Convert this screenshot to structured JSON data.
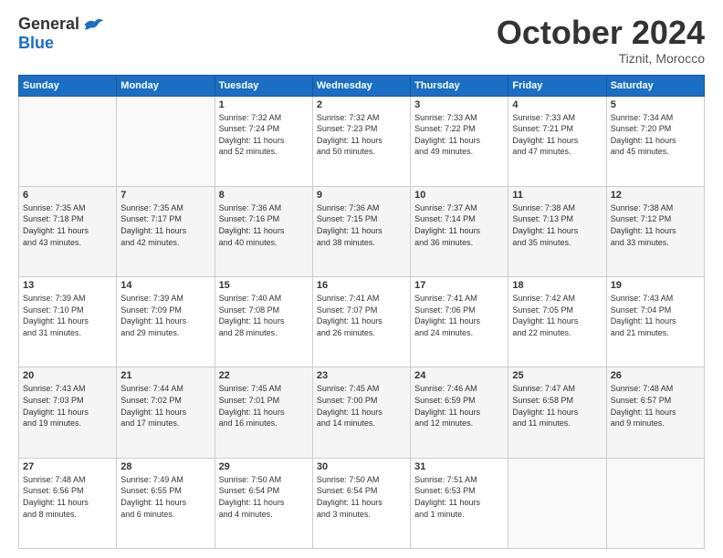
{
  "logo": {
    "general": "General",
    "blue": "Blue"
  },
  "title": "October 2024",
  "location": "Tiznit, Morocco",
  "days_of_week": [
    "Sunday",
    "Monday",
    "Tuesday",
    "Wednesday",
    "Thursday",
    "Friday",
    "Saturday"
  ],
  "weeks": [
    {
      "shaded": false,
      "days": [
        {
          "day": "",
          "info": ""
        },
        {
          "day": "",
          "info": ""
        },
        {
          "day": "1",
          "info": "Sunrise: 7:32 AM\nSunset: 7:24 PM\nDaylight: 11 hours\nand 52 minutes."
        },
        {
          "day": "2",
          "info": "Sunrise: 7:32 AM\nSunset: 7:23 PM\nDaylight: 11 hours\nand 50 minutes."
        },
        {
          "day": "3",
          "info": "Sunrise: 7:33 AM\nSunset: 7:22 PM\nDaylight: 11 hours\nand 49 minutes."
        },
        {
          "day": "4",
          "info": "Sunrise: 7:33 AM\nSunset: 7:21 PM\nDaylight: 11 hours\nand 47 minutes."
        },
        {
          "day": "5",
          "info": "Sunrise: 7:34 AM\nSunset: 7:20 PM\nDaylight: 11 hours\nand 45 minutes."
        }
      ]
    },
    {
      "shaded": true,
      "days": [
        {
          "day": "6",
          "info": "Sunrise: 7:35 AM\nSunset: 7:18 PM\nDaylight: 11 hours\nand 43 minutes."
        },
        {
          "day": "7",
          "info": "Sunrise: 7:35 AM\nSunset: 7:17 PM\nDaylight: 11 hours\nand 42 minutes."
        },
        {
          "day": "8",
          "info": "Sunrise: 7:36 AM\nSunset: 7:16 PM\nDaylight: 11 hours\nand 40 minutes."
        },
        {
          "day": "9",
          "info": "Sunrise: 7:36 AM\nSunset: 7:15 PM\nDaylight: 11 hours\nand 38 minutes."
        },
        {
          "day": "10",
          "info": "Sunrise: 7:37 AM\nSunset: 7:14 PM\nDaylight: 11 hours\nand 36 minutes."
        },
        {
          "day": "11",
          "info": "Sunrise: 7:38 AM\nSunset: 7:13 PM\nDaylight: 11 hours\nand 35 minutes."
        },
        {
          "day": "12",
          "info": "Sunrise: 7:38 AM\nSunset: 7:12 PM\nDaylight: 11 hours\nand 33 minutes."
        }
      ]
    },
    {
      "shaded": false,
      "days": [
        {
          "day": "13",
          "info": "Sunrise: 7:39 AM\nSunset: 7:10 PM\nDaylight: 11 hours\nand 31 minutes."
        },
        {
          "day": "14",
          "info": "Sunrise: 7:39 AM\nSunset: 7:09 PM\nDaylight: 11 hours\nand 29 minutes."
        },
        {
          "day": "15",
          "info": "Sunrise: 7:40 AM\nSunset: 7:08 PM\nDaylight: 11 hours\nand 28 minutes."
        },
        {
          "day": "16",
          "info": "Sunrise: 7:41 AM\nSunset: 7:07 PM\nDaylight: 11 hours\nand 26 minutes."
        },
        {
          "day": "17",
          "info": "Sunrise: 7:41 AM\nSunset: 7:06 PM\nDaylight: 11 hours\nand 24 minutes."
        },
        {
          "day": "18",
          "info": "Sunrise: 7:42 AM\nSunset: 7:05 PM\nDaylight: 11 hours\nand 22 minutes."
        },
        {
          "day": "19",
          "info": "Sunrise: 7:43 AM\nSunset: 7:04 PM\nDaylight: 11 hours\nand 21 minutes."
        }
      ]
    },
    {
      "shaded": true,
      "days": [
        {
          "day": "20",
          "info": "Sunrise: 7:43 AM\nSunset: 7:03 PM\nDaylight: 11 hours\nand 19 minutes."
        },
        {
          "day": "21",
          "info": "Sunrise: 7:44 AM\nSunset: 7:02 PM\nDaylight: 11 hours\nand 17 minutes."
        },
        {
          "day": "22",
          "info": "Sunrise: 7:45 AM\nSunset: 7:01 PM\nDaylight: 11 hours\nand 16 minutes."
        },
        {
          "day": "23",
          "info": "Sunrise: 7:45 AM\nSunset: 7:00 PM\nDaylight: 11 hours\nand 14 minutes."
        },
        {
          "day": "24",
          "info": "Sunrise: 7:46 AM\nSunset: 6:59 PM\nDaylight: 11 hours\nand 12 minutes."
        },
        {
          "day": "25",
          "info": "Sunrise: 7:47 AM\nSunset: 6:58 PM\nDaylight: 11 hours\nand 11 minutes."
        },
        {
          "day": "26",
          "info": "Sunrise: 7:48 AM\nSunset: 6:57 PM\nDaylight: 11 hours\nand 9 minutes."
        }
      ]
    },
    {
      "shaded": false,
      "days": [
        {
          "day": "27",
          "info": "Sunrise: 7:48 AM\nSunset: 6:56 PM\nDaylight: 11 hours\nand 8 minutes."
        },
        {
          "day": "28",
          "info": "Sunrise: 7:49 AM\nSunset: 6:55 PM\nDaylight: 11 hours\nand 6 minutes."
        },
        {
          "day": "29",
          "info": "Sunrise: 7:50 AM\nSunset: 6:54 PM\nDaylight: 11 hours\nand 4 minutes."
        },
        {
          "day": "30",
          "info": "Sunrise: 7:50 AM\nSunset: 6:54 PM\nDaylight: 11 hours\nand 3 minutes."
        },
        {
          "day": "31",
          "info": "Sunrise: 7:51 AM\nSunset: 6:53 PM\nDaylight: 11 hours\nand 1 minute."
        },
        {
          "day": "",
          "info": ""
        },
        {
          "day": "",
          "info": ""
        }
      ]
    }
  ]
}
